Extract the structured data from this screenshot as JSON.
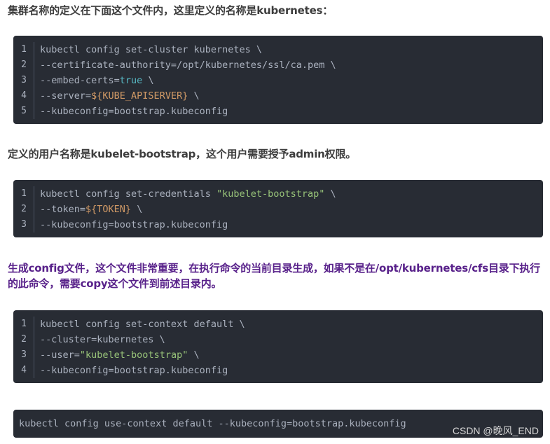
{
  "paragraphs": [
    "集群名称的定义在下面这个文件内，这里定义的名称是kubernetes：",
    "定义的用户名称是kubelet-bootstrap，这个用户需要授予admin权限。",
    "生成config文件，这个文件非常重要，在执行命令的当前目录生成，如果不是在/opt/kubernetes/cfs目录下执行的此命令，需要copy这个文件到前述目录内。"
  ],
  "code_blocks": [
    {
      "lines": [
        {
          "no": "1",
          "tokens": [
            {
              "t": "kubectl config set-cluster kubernetes \\",
              "c": ""
            }
          ]
        },
        {
          "no": "2",
          "tokens": [
            {
              "t": "--certificate-authority=/opt/kubernetes/ssl/ca.pem \\",
              "c": ""
            }
          ]
        },
        {
          "no": "3",
          "tokens": [
            {
              "t": "--embed-certs=",
              "c": ""
            },
            {
              "t": "true",
              "c": "keyword"
            },
            {
              "t": " \\",
              "c": ""
            }
          ]
        },
        {
          "no": "4",
          "tokens": [
            {
              "t": "--server=",
              "c": ""
            },
            {
              "t": "${KUBE_APISERVER}",
              "c": "var"
            },
            {
              "t": " \\",
              "c": ""
            }
          ]
        },
        {
          "no": "5",
          "tokens": [
            {
              "t": "--kubeconfig=bootstrap.kubeconfig",
              "c": ""
            }
          ]
        }
      ]
    },
    {
      "lines": [
        {
          "no": "1",
          "tokens": [
            {
              "t": "kubectl config set-credentials ",
              "c": ""
            },
            {
              "t": "\"kubelet-bootstrap\"",
              "c": "string"
            },
            {
              "t": " \\",
              "c": ""
            }
          ]
        },
        {
          "no": "2",
          "tokens": [
            {
              "t": "--token=",
              "c": ""
            },
            {
              "t": "${TOKEN}",
              "c": "var"
            },
            {
              "t": " \\",
              "c": ""
            }
          ]
        },
        {
          "no": "3",
          "tokens": [
            {
              "t": "--kubeconfig=bootstrap.kubeconfig",
              "c": ""
            }
          ]
        }
      ]
    },
    {
      "lines": [
        {
          "no": "1",
          "tokens": [
            {
              "t": "kubectl config set-context default \\",
              "c": ""
            }
          ]
        },
        {
          "no": "2",
          "tokens": [
            {
              "t": "--cluster=kubernetes \\",
              "c": ""
            }
          ]
        },
        {
          "no": "3",
          "tokens": [
            {
              "t": "--user=",
              "c": ""
            },
            {
              "t": "\"kubelet-bootstrap\"",
              "c": "string"
            },
            {
              "t": " \\",
              "c": ""
            }
          ]
        },
        {
          "no": "4",
          "tokens": [
            {
              "t": "--kubeconfig=bootstrap.kubeconfig",
              "c": ""
            }
          ]
        }
      ]
    }
  ],
  "single_line_code": "kubectl config use-context default --kubeconfig=bootstrap.kubeconfig",
  "watermark": "CSDN @晚风_END",
  "colors": {
    "code_bg": "#282c34",
    "code_text": "#abb2bf",
    "keyword": "#56b6c2",
    "string": "#98c379",
    "variable": "#d19a66",
    "paragraph_text": "#3d3d3d",
    "highlight_paragraph": "#58218a"
  }
}
